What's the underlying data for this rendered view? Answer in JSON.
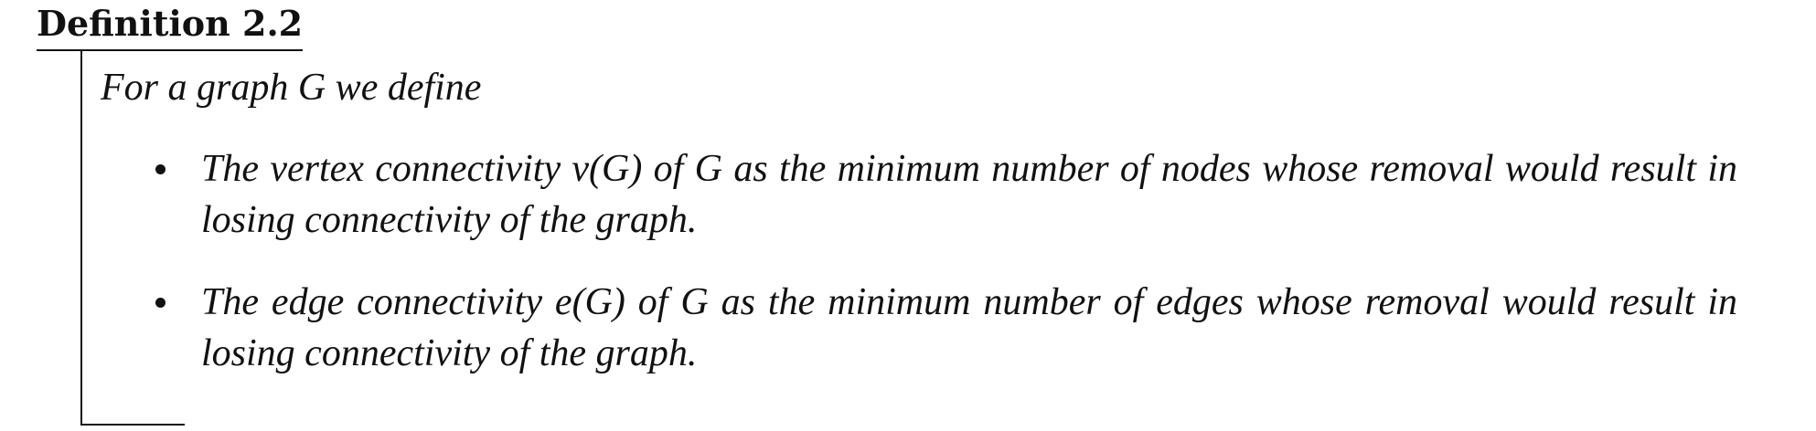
{
  "definition": {
    "title": "Definition 2.2",
    "intro": "For a graph G we define",
    "items": [
      "The vertex connectivity v(G) of G as the minimum number of nodes whose removal would result in losing connectivity of the graph.",
      "The edge connectivity e(G) of G as the minimum number of edges whose removal would result in losing connectivity of the graph."
    ]
  }
}
